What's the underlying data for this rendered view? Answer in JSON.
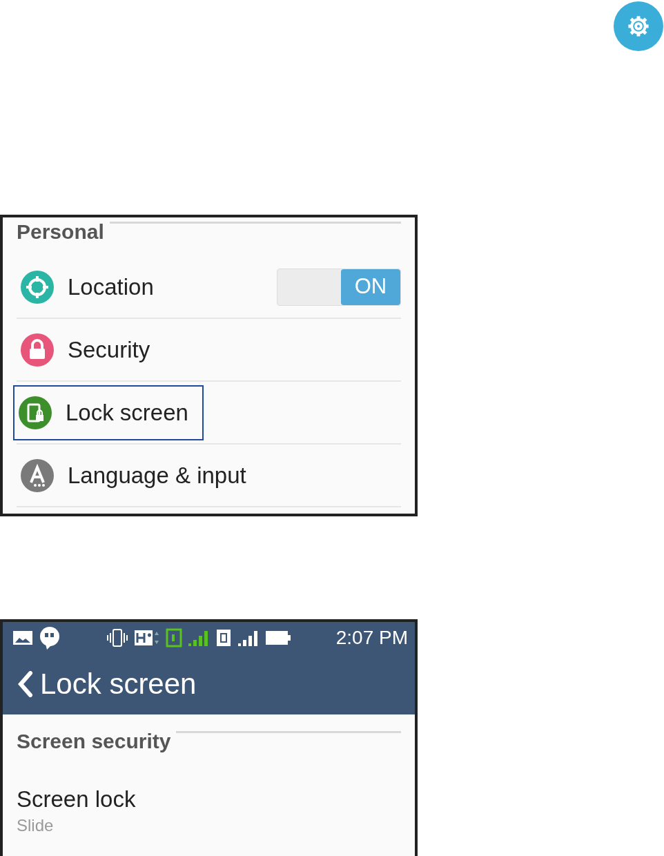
{
  "personal_panel": {
    "section_title": "Personal",
    "items": [
      {
        "label": "Location",
        "kind": "toggle",
        "color": "#2bb5a5",
        "highlighted": false,
        "toggle": {
          "on": true,
          "label": "ON"
        }
      },
      {
        "label": "Security",
        "kind": "link",
        "color": "#e8557a",
        "highlighted": false
      },
      {
        "label": "Lock screen",
        "kind": "link",
        "color": "#3c8f2a",
        "highlighted": true
      },
      {
        "label": "Language & input",
        "kind": "link",
        "color": "#7a7a7a",
        "highlighted": false
      }
    ]
  },
  "lock_screen_panel": {
    "status_bar": {
      "time": "2:07 PM"
    },
    "title": "Lock screen",
    "section_title": "Screen security",
    "items": [
      {
        "label": "Screen lock",
        "summary": "Slide"
      }
    ]
  }
}
